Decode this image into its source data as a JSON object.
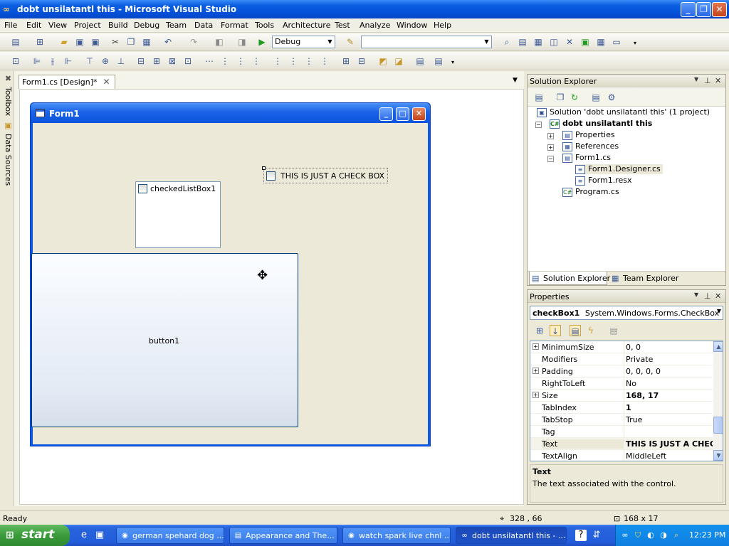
{
  "window": {
    "title": "dobt unsilatantl this - Microsoft Visual Studio",
    "app_icon": "visual-studio-icon",
    "minimize": "_",
    "maximize": "❐",
    "close": "✕"
  },
  "menu": [
    "File",
    "Edit",
    "View",
    "Project",
    "Build",
    "Debug",
    "Team",
    "Data",
    "Format",
    "Tools",
    "Architecture",
    "Test",
    "Analyze",
    "Window",
    "Help"
  ],
  "toolbar": {
    "config_value": "Debug",
    "platform_value": ""
  },
  "left_dock": {
    "toolbox": "Toolbox",
    "data_sources": "Data Sources"
  },
  "document": {
    "tab_label": "Form1.cs [Design]*",
    "tab_close": "✕"
  },
  "form": {
    "title": "Form1",
    "checked_list_item": "checkedListBox1",
    "checkbox_text": "THIS IS JUST A CHECK BOX",
    "button_text": "button1"
  },
  "solution_explorer": {
    "title": "Solution Explorer",
    "solution": "Solution 'dobt unsilatantl this' (1 project)",
    "project": "dobt unsilatantl this",
    "items": {
      "properties": "Properties",
      "references": "References",
      "form1": "Form1.cs",
      "form1_designer": "Form1.Designer.cs",
      "form1_resx": "Form1.resx",
      "program": "Program.cs"
    },
    "tab_solution": "Solution Explorer",
    "tab_team": "Team Explorer"
  },
  "properties": {
    "title": "Properties",
    "object_name": "checkBox1",
    "object_type": "System.Windows.Forms.CheckBox",
    "rows": [
      {
        "name": "MinimumSize",
        "value": "0, 0",
        "expandable": true,
        "bold": false
      },
      {
        "name": "Modifiers",
        "value": "Private",
        "expandable": false,
        "bold": false
      },
      {
        "name": "Padding",
        "value": "0, 0, 0, 0",
        "expandable": true,
        "bold": false
      },
      {
        "name": "RightToLeft",
        "value": "No",
        "expandable": false,
        "bold": false
      },
      {
        "name": "Size",
        "value": "168, 17",
        "expandable": true,
        "bold": true
      },
      {
        "name": "TabIndex",
        "value": "1",
        "expandable": false,
        "bold": true
      },
      {
        "name": "TabStop",
        "value": "True",
        "expandable": false,
        "bold": false
      },
      {
        "name": "Tag",
        "value": "",
        "expandable": false,
        "bold": false
      },
      {
        "name": "Text",
        "value": "THIS IS JUST A CHECK",
        "expandable": false,
        "bold": true
      },
      {
        "name": "TextAlign",
        "value": "MiddleLeft",
        "expandable": false,
        "bold": false
      }
    ],
    "desc_title": "Text",
    "desc_text": "The text associated with the control."
  },
  "statusbar": {
    "state": "Ready",
    "position": "328 , 66",
    "size": "168 x 17"
  },
  "taskbar": {
    "start": "start",
    "tasks": [
      {
        "label": "german spehard dog ...",
        "active": false
      },
      {
        "label": "Appearance and The...",
        "active": false
      },
      {
        "label": "watch spark live chnl ...",
        "active": false
      },
      {
        "label": "dobt unsilatantl this - ...",
        "active": true
      }
    ],
    "clock": "12:23 PM"
  }
}
